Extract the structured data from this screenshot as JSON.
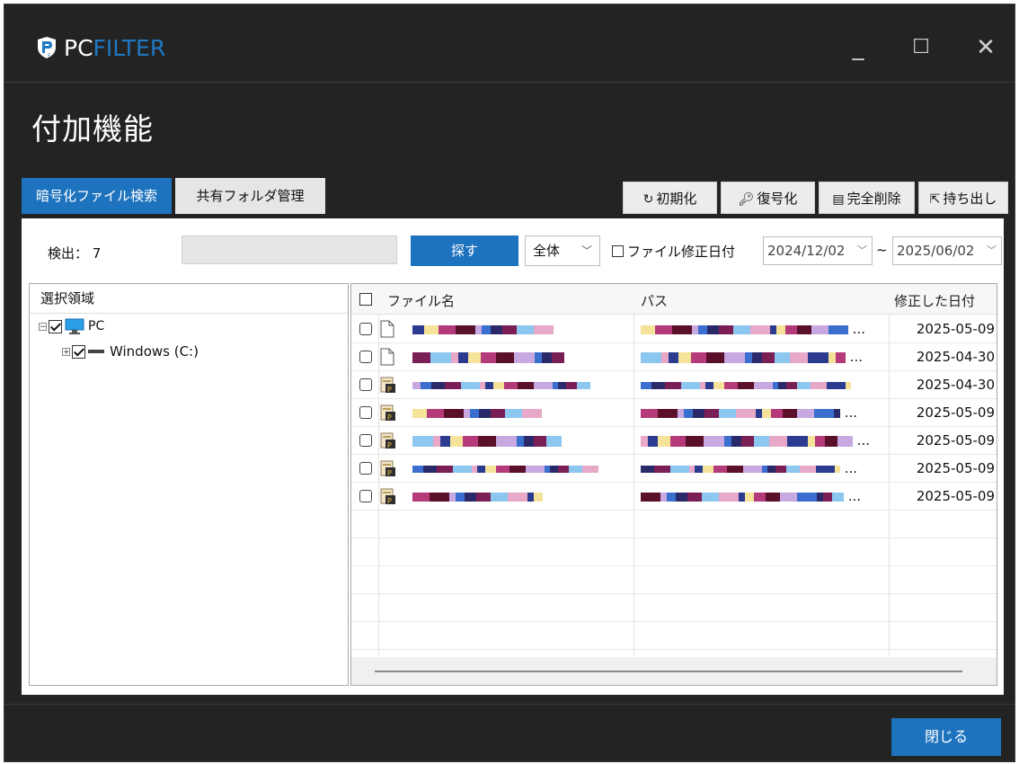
{
  "app": {
    "brand_part1": "PC",
    "brand_part2": "FILTER",
    "window_controls": {
      "minimize": "_",
      "maximize": "☐",
      "close": "✕"
    }
  },
  "page_title": "付加機能",
  "tabs": [
    {
      "label": "暗号化ファイル検索",
      "active": true
    },
    {
      "label": "共有フォルダ管理",
      "active": false
    }
  ],
  "actions": {
    "reset": {
      "label": "初期化",
      "icon": "refresh-icon"
    },
    "decrypt": {
      "label": "復号化",
      "icon": "key-icon"
    },
    "delete": {
      "label": "完全削除",
      "icon": "shred-icon"
    },
    "export": {
      "label": "持ち出し",
      "icon": "export-icon"
    }
  },
  "search": {
    "detect_label": "検出： 7",
    "query_value": "",
    "search_button": "探す",
    "scope_value": "全体",
    "date_filter_label": "ファイル修正日付",
    "date_from": "2024/12/02",
    "date_to": "2025/06/02",
    "tilde": "~"
  },
  "tree": {
    "header": "選択領域",
    "root_label": "PC",
    "drive_label": "Windows (C:)"
  },
  "files": {
    "headers": {
      "name": "ファイル名",
      "path": "パス",
      "date": "修正した日付"
    },
    "rows": [
      {
        "date": "2025-05-09",
        "icon": "blank-file-icon",
        "path_ellipsis": "..."
      },
      {
        "date": "2025-04-30",
        "icon": "blank-file-icon",
        "path_ellipsis": "..."
      },
      {
        "date": "2025-04-30",
        "icon": "encrypted-file-icon",
        "path_ellipsis": ""
      },
      {
        "date": "2025-05-09",
        "icon": "encrypted-file-icon",
        "path_ellipsis": "..."
      },
      {
        "date": "2025-05-09",
        "icon": "encrypted-file-icon",
        "path_ellipsis": "..."
      },
      {
        "date": "2025-05-09",
        "icon": "encrypted-file-icon",
        "path_ellipsis": "..."
      },
      {
        "date": "2025-05-09",
        "icon": "encrypted-file-icon",
        "path_ellipsis": "..."
      }
    ]
  },
  "footer": {
    "close_button": "閉じる"
  },
  "colors": {
    "accent": "#1e73be",
    "window_bg": "#232323",
    "brand_blue": "#1e78c2"
  }
}
